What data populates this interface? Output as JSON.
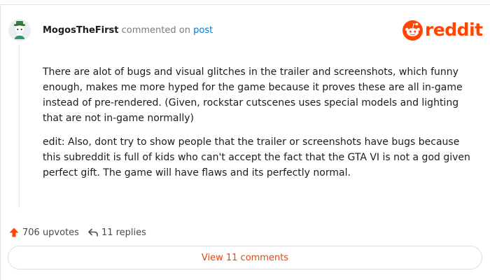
{
  "comment": {
    "username": "MogosTheFirst",
    "action_text": "commented on",
    "post_link": "post",
    "paragraphs": [
      "There are alot of bugs and visual glitches in the trailer and screenshots, which funny enough, makes me more hyped for the game because it proves these are all in-game instead of pre-rendered. (Given, rockstar cutscenes uses special models and lighting that are not in-game normally)",
      "edit: Also, dont try to show people that the trailer or screenshots have bugs because this subreddit is full of kids who can't accept the fact that the GTA VI is not a god given perfect gift. The game will have flaws and its perfectly normal."
    ]
  },
  "logo": {
    "text": "reddit",
    "icon": "reddit-snoo-icon",
    "color": "#ff4500"
  },
  "footer": {
    "upvotes": "706 upvotes",
    "replies": "11 replies",
    "upvote_icon": "upvote-arrow-icon",
    "reply_icon": "reply-arrow-icon",
    "upvote_color": "#ff4500"
  },
  "view_button": {
    "label": "View 11 comments",
    "color": "#e0490f"
  },
  "avatar": {
    "icon": "user-avatar-icon"
  }
}
